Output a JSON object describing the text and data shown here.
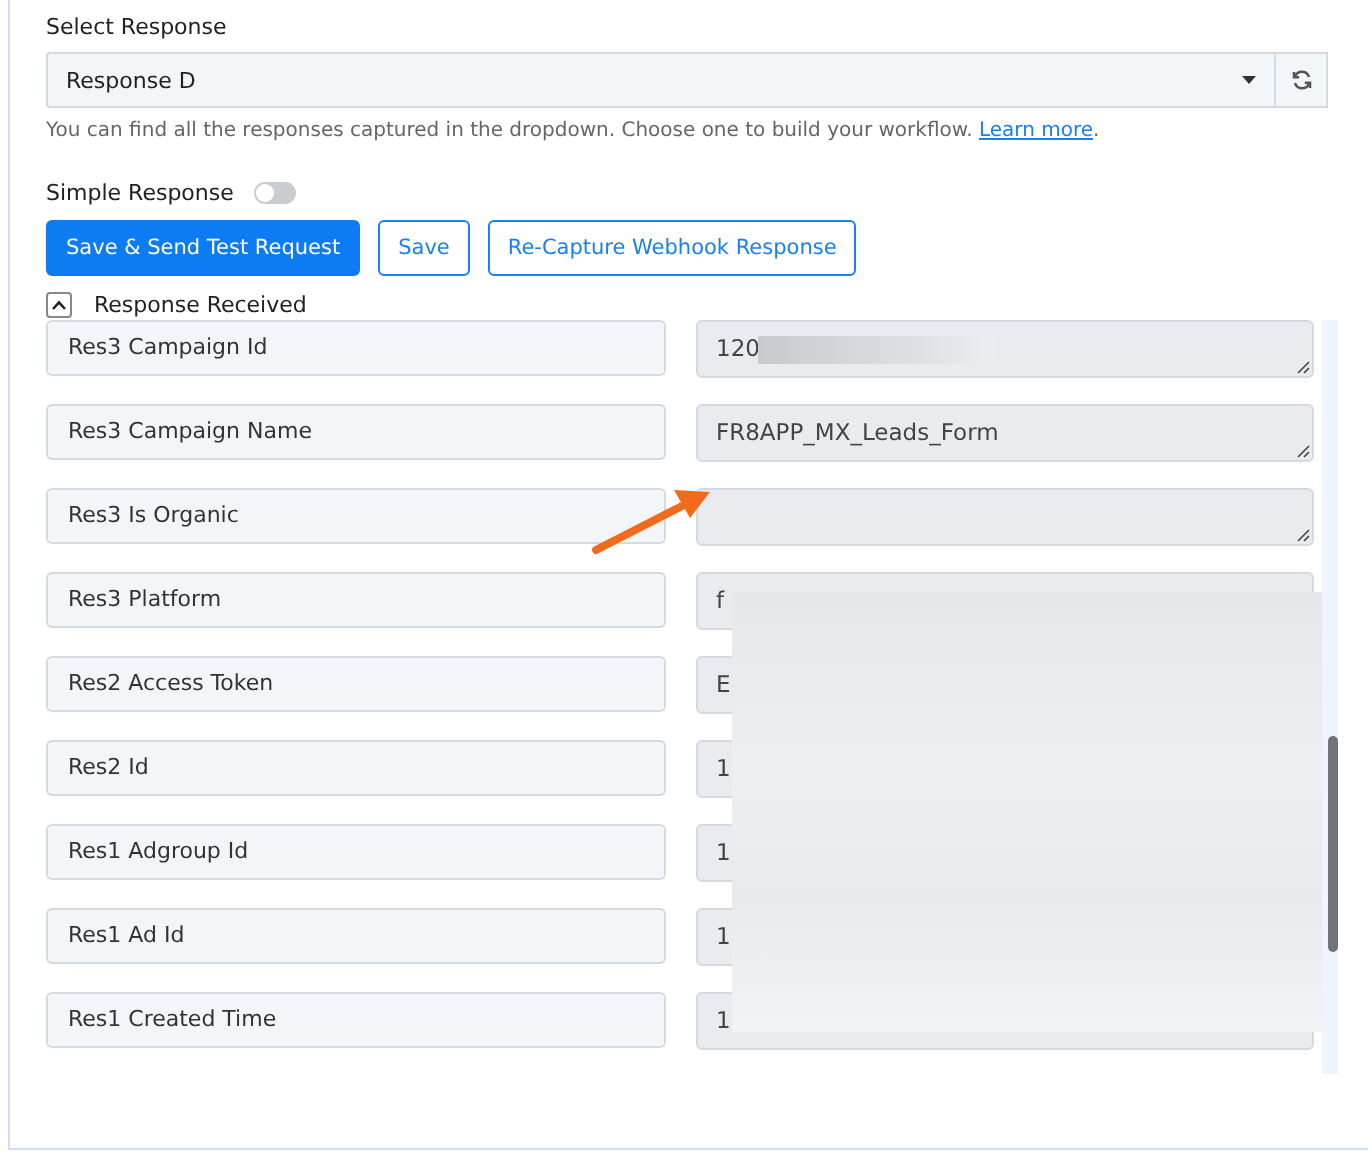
{
  "select_response": {
    "label": "Select Response",
    "value": "Response D",
    "help": "You can find all the responses captured in the dropdown. Choose one to build your workflow. ",
    "help_link": "Learn more",
    "help_end": "."
  },
  "simple_response": {
    "label": "Simple Response",
    "on": false
  },
  "buttons": [
    {
      "label": "Save & Send Test Request",
      "kind": "primary"
    },
    {
      "label": "Save",
      "kind": "outline"
    },
    {
      "label": "Re-Capture Webhook Response",
      "kind": "outline"
    }
  ],
  "response_received": {
    "label": "Response Received",
    "expanded": true,
    "rows": [
      {
        "label": "Res3 Campaign Id",
        "value": "120"
      },
      {
        "label": "Res3 Campaign Name",
        "value": "FR8APP_MX_Leads_Form"
      },
      {
        "label": "Res3 Is Organic"
      },
      {
        "label": "Res3 Platform",
        "value": "f"
      },
      {
        "label": "Res2 Access Token",
        "value": "E"
      },
      {
        "label": "Res2 Id",
        "value": "1"
      },
      {
        "label": "Res1 Adgroup Id",
        "value": "1"
      },
      {
        "label": "Res1 Ad Id",
        "value": "1"
      },
      {
        "label": "Res1 Created Time",
        "value": "1"
      },
      {}
    ]
  }
}
